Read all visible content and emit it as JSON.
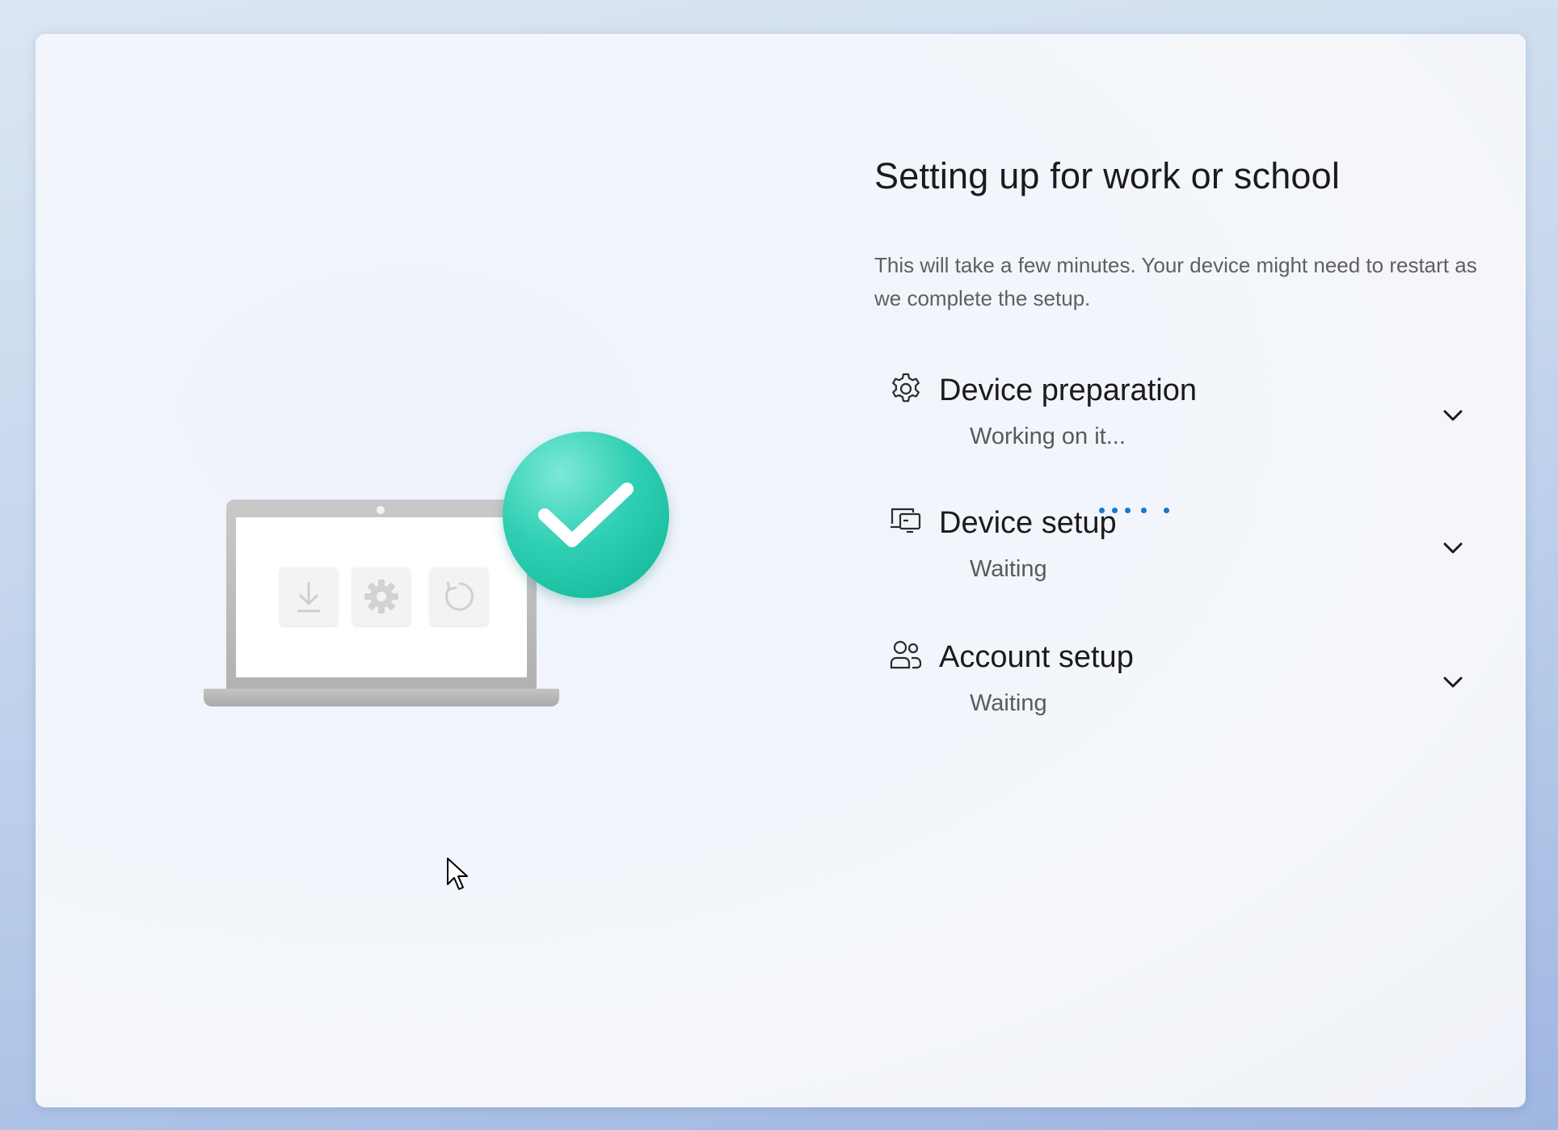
{
  "page": {
    "title": "Setting up for work or school",
    "subtitle": "This will take a few minutes. Your device might need to restart as we complete the setup."
  },
  "steps": [
    {
      "title": "Device preparation",
      "status": "Working on it...",
      "icon": "gear-icon",
      "state": "in-progress"
    },
    {
      "title": "Device setup",
      "status": "Waiting",
      "icon": "devices-icon",
      "state": "waiting"
    },
    {
      "title": "Account setup",
      "status": "Waiting",
      "icon": "people-icon",
      "state": "waiting"
    }
  ],
  "illustration": {
    "tiles": [
      "download-icon",
      "gear-icon",
      "restart-icon"
    ],
    "badge": "checkmark-icon"
  },
  "colors": {
    "accent": "#1677d2",
    "badge": "#2fcfb3",
    "title_text": "#1b1b1b",
    "secondary_text": "#5a5a5a"
  }
}
